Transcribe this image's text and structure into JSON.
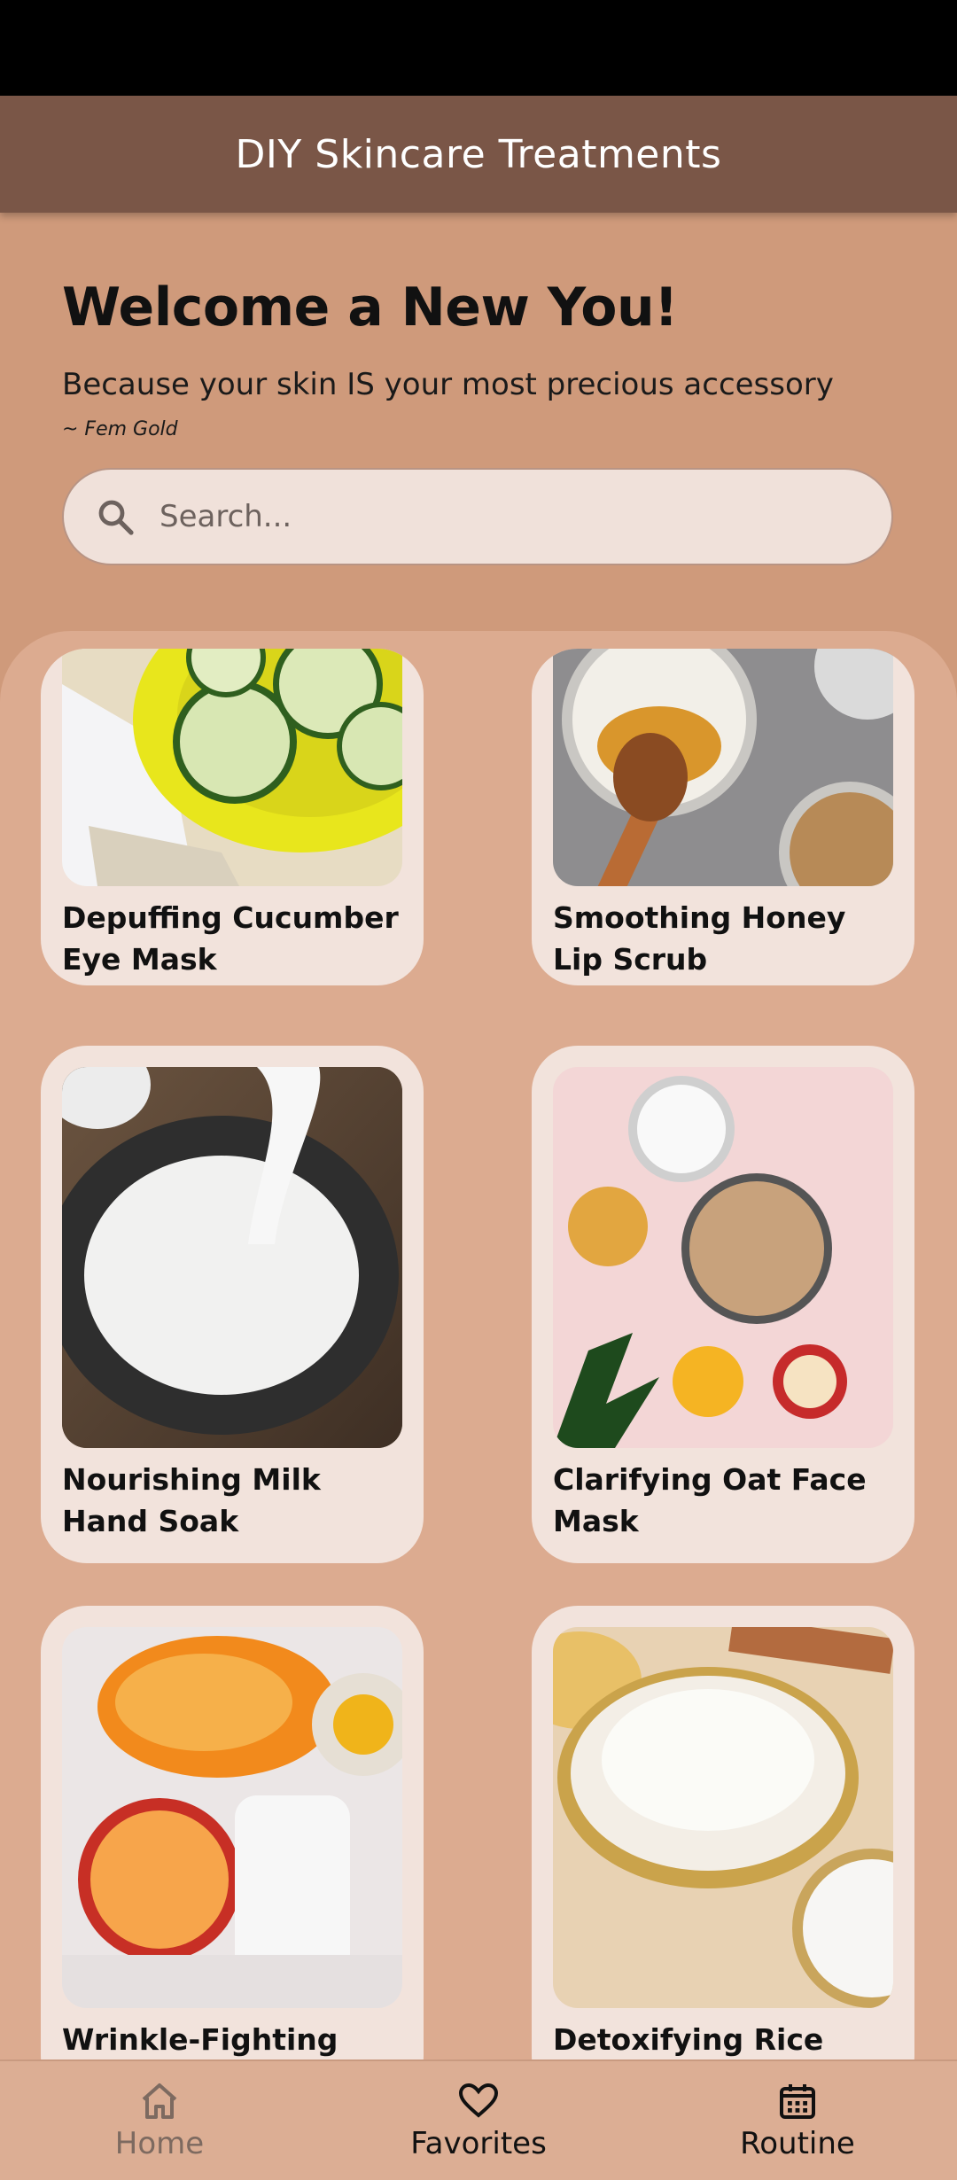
{
  "app": {
    "title": "DIY Skincare Treatments"
  },
  "welcome": {
    "title": "Welcome a New You!",
    "subtitle": "Because your skin IS your most precious accessory",
    "author": "~ Fem Gold"
  },
  "search": {
    "placeholder": "Search..."
  },
  "treatments": [
    {
      "title": "Depuffing Cucumber Eye Mask",
      "image_icon": "cucumber-image"
    },
    {
      "title": "Smoothing Honey Lip Scrub",
      "image_icon": "honey-image"
    },
    {
      "title": "Nourishing Milk Hand Soak",
      "image_icon": "milk-image"
    },
    {
      "title": "Clarifying Oat Face Mask",
      "image_icon": "oat-image"
    },
    {
      "title": "Wrinkle-Fighting",
      "image_icon": "papaya-image"
    },
    {
      "title": "Detoxifying Rice Ginger",
      "image_icon": "rice-image"
    }
  ],
  "nav": {
    "home": "Home",
    "favorites": "Favorites",
    "routine": "Routine"
  },
  "colors": {
    "app_bar": "#7a5647",
    "background": "#cf9a7b",
    "card": "#f2e3dc"
  }
}
